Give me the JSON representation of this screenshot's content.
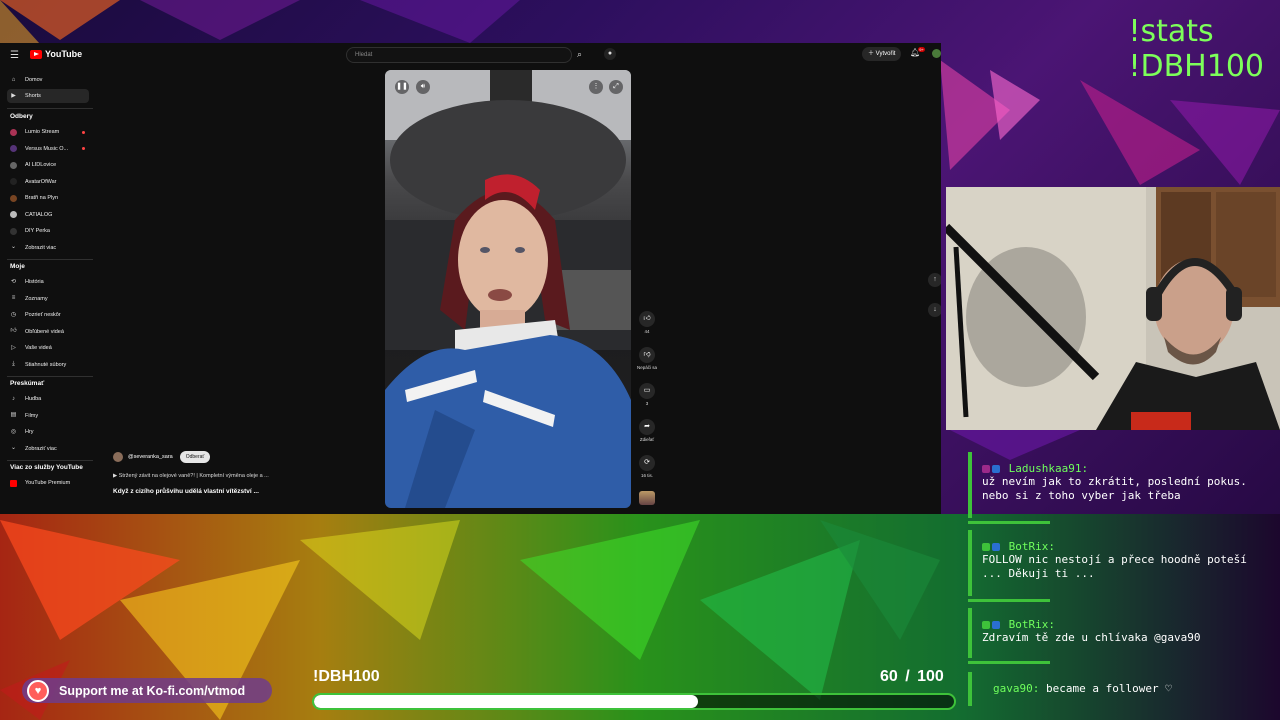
{
  "stats": {
    "line1": "!stats",
    "line2": "!DBH100"
  },
  "youtube": {
    "brand": "YouTube",
    "search_placeholder": "Hledat",
    "create_label": "Vytvořit",
    "notification_count": "9+",
    "sidebar": {
      "main": [
        {
          "label": "Domov",
          "icon": "home-icon"
        },
        {
          "label": "Shorts",
          "icon": "shorts-icon",
          "active": true
        }
      ],
      "subs_heading": "Odbery",
      "subs": [
        {
          "label": "Lumio Stream",
          "live": true
        },
        {
          "label": "Versus Music O...",
          "live": true
        },
        {
          "label": "AI LIDLovice",
          "live": false
        },
        {
          "label": "AvatarOfWar",
          "live": false
        },
        {
          "label": "Bratři na Plyn",
          "live": false
        },
        {
          "label": "CATIALOG",
          "live": false
        },
        {
          "label": "DIY Perka",
          "live": false
        },
        {
          "label": "Zobrazit viac",
          "live": false
        }
      ],
      "mine_heading": "Moje",
      "mine": [
        "História",
        "Zoznamy",
        "Pozrieť neskôr",
        "Obľúbené videá",
        "Vaše videá",
        "Stiahnuté súbory"
      ],
      "explore_heading": "Preskúmať",
      "explore": [
        "Hudba",
        "Filmy",
        "Hry",
        "Zobraziť viac"
      ],
      "more_heading": "Viac zo služby YouTube",
      "more": [
        "YouTube Premium"
      ]
    },
    "short": {
      "channel": "@severanka_sara",
      "subscribe_label": "Odberať",
      "description": "▶ Stržený závit na olejové vaně?! | Kompletní výměna oleje a ...",
      "title": "Když z cizího průšvihu udělá vlastní vítězství ...",
      "actions": [
        {
          "label": "44",
          "icon": "like-icon"
        },
        {
          "label": "Nepáči sa",
          "icon": "dislike-icon"
        },
        {
          "label": "3",
          "icon": "comment-icon"
        },
        {
          "label": "Zdieľať",
          "icon": "share-icon"
        },
        {
          "label": "16 tis.",
          "icon": "remix-icon"
        }
      ]
    }
  },
  "chat": [
    {
      "user": "Ladushkaa91:",
      "text": "už nevím jak to zkrátit, poslední pokus. nebo si z toho vyber jak třeba"
    },
    {
      "user": "BotRix:",
      "text": "FOLLOW nic nestojí a přece hoodně poteší ... Děkuji ti ..."
    },
    {
      "user": "BotRix:",
      "text": "Zdravím tě zde u chlívaka @gava90"
    }
  ],
  "follow_event": {
    "user": "gava90:",
    "text": "became a follower ♡"
  },
  "kofi": {
    "label": "Support me at Ko-fi.com/vtmod"
  },
  "goal": {
    "label": "!DBH100",
    "current": 60,
    "target": 100,
    "count_text": "60 / 100",
    "fraction": 0.6
  },
  "colors": {
    "accent_green": "#3ec23a",
    "yt_red": "#ff0000",
    "kofi": "#ff5e5b"
  }
}
